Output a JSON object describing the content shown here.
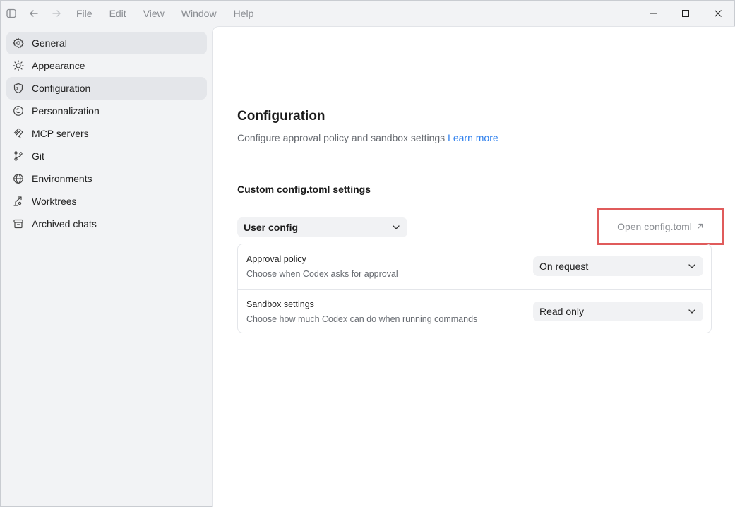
{
  "menubar": {
    "items": [
      "File",
      "Edit",
      "View",
      "Window",
      "Help"
    ]
  },
  "sidebar": {
    "items": [
      {
        "label": "General",
        "icon": "gear-icon",
        "active": false
      },
      {
        "label": "Appearance",
        "icon": "sun-icon",
        "active": false
      },
      {
        "label": "Configuration",
        "icon": "shield-icon",
        "active": true
      },
      {
        "label": "Personalization",
        "icon": "smile-icon",
        "active": false
      },
      {
        "label": "MCP servers",
        "icon": "mcp-icon",
        "active": false
      },
      {
        "label": "Git",
        "icon": "git-branch-icon",
        "active": false
      },
      {
        "label": "Environments",
        "icon": "globe-icon",
        "active": false
      },
      {
        "label": "Worktrees",
        "icon": "worktree-icon",
        "active": false
      },
      {
        "label": "Archived chats",
        "icon": "archive-icon",
        "active": false
      }
    ]
  },
  "main": {
    "title": "Configuration",
    "description": "Configure approval policy and sandbox settings",
    "learn_more": "Learn more",
    "section_title": "Custom config.toml settings",
    "config_select": "User config",
    "open_config": "Open config.toml",
    "settings": [
      {
        "title": "Approval policy",
        "subtitle": "Choose when Codex asks for approval",
        "value": "On request"
      },
      {
        "title": "Sandbox settings",
        "subtitle": "Choose how much Codex can do when running commands",
        "value": "Read only"
      }
    ]
  },
  "colors": {
    "accent": "#2f80ed",
    "highlight_border": "#e05b5b",
    "sidebar_active": "#e4e6ea"
  }
}
